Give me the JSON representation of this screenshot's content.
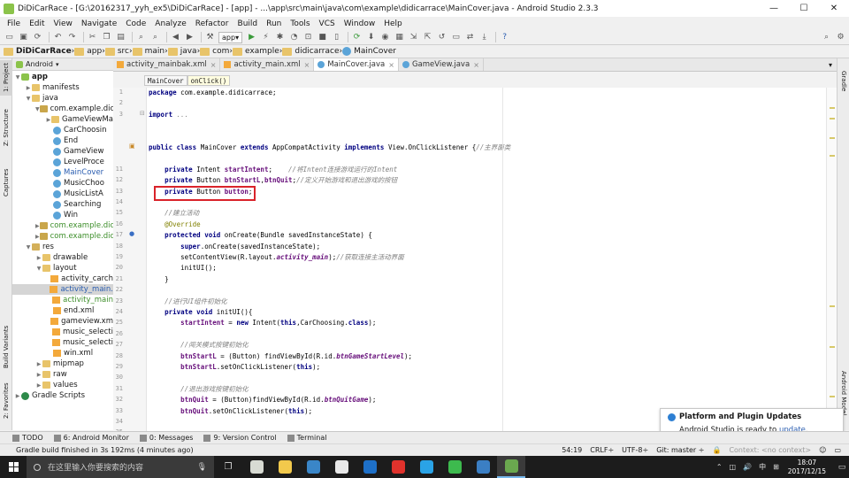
{
  "window": {
    "title": "DiDiCarRace - [G:\\20162317_yyh_ex5\\DiDiCarRace] - [app] - ...\\app\\src\\main\\java\\com\\example\\didicarrace\\MainCover.java - Android Studio 2.3.3"
  },
  "menu": [
    "File",
    "Edit",
    "View",
    "Navigate",
    "Code",
    "Analyze",
    "Refactor",
    "Build",
    "Run",
    "Tools",
    "VCS",
    "Window",
    "Help"
  ],
  "toolbar": {
    "run_config": "app",
    "run_config_arrow": "▾"
  },
  "breadcrumb": [
    "DiDiCarRace",
    "app",
    "src",
    "main",
    "java",
    "com",
    "example",
    "didicarrace",
    "MainCover"
  ],
  "project_panel": {
    "view_mode": "Android"
  },
  "tree": [
    {
      "label": "app",
      "depth": 0,
      "icon": "module",
      "arrow": "▼",
      "bold": true
    },
    {
      "label": "manifests",
      "depth": 1,
      "icon": "folder",
      "arrow": "▶"
    },
    {
      "label": "java",
      "depth": 1,
      "icon": "folder",
      "arrow": "▼"
    },
    {
      "label": "com.example.dic",
      "depth": 2,
      "icon": "pkg",
      "arrow": "▼"
    },
    {
      "label": "GameViewMa",
      "depth": 3,
      "icon": "folder",
      "arrow": "▶"
    },
    {
      "label": "CarChoosin",
      "depth": 3,
      "icon": "cls",
      "arrow": ""
    },
    {
      "label": "End",
      "depth": 3,
      "icon": "cls",
      "arrow": ""
    },
    {
      "label": "GameView",
      "depth": 3,
      "icon": "cls",
      "arrow": ""
    },
    {
      "label": "LevelProce",
      "depth": 3,
      "icon": "cls",
      "arrow": ""
    },
    {
      "label": "MainCover",
      "depth": 3,
      "icon": "cls",
      "arrow": "",
      "color": "#2a5db0"
    },
    {
      "label": "MusicChoo",
      "depth": 3,
      "icon": "cls",
      "arrow": ""
    },
    {
      "label": "MusicListA",
      "depth": 3,
      "icon": "cls",
      "arrow": ""
    },
    {
      "label": "Searching",
      "depth": 3,
      "icon": "cls",
      "arrow": ""
    },
    {
      "label": "Win",
      "depth": 3,
      "icon": "cls",
      "arrow": ""
    },
    {
      "label": "com.example.dic",
      "depth": 2,
      "icon": "pkg",
      "arrow": "▶",
      "variant": "green"
    },
    {
      "label": "com.example.dic",
      "depth": 2,
      "icon": "pkg",
      "arrow": "▶",
      "variant": "green"
    },
    {
      "label": "res",
      "depth": 1,
      "icon": "res",
      "arrow": "▼"
    },
    {
      "label": "drawable",
      "depth": 2,
      "icon": "folder",
      "arrow": "▶"
    },
    {
      "label": "layout",
      "depth": 2,
      "icon": "folder",
      "arrow": "▼"
    },
    {
      "label": "activity_carch",
      "depth": 3,
      "icon": "xml",
      "arrow": ""
    },
    {
      "label": "activity_main.",
      "depth": 3,
      "icon": "xml",
      "arrow": "",
      "selected": true,
      "color": "#2a5db0"
    },
    {
      "label": "activity_main",
      "depth": 3,
      "icon": "xml",
      "arrow": "",
      "variant": "green"
    },
    {
      "label": "end.xml",
      "depth": 3,
      "icon": "xml",
      "arrow": ""
    },
    {
      "label": "gameview.xm",
      "depth": 3,
      "icon": "xml",
      "arrow": ""
    },
    {
      "label": "music_selecti",
      "depth": 3,
      "icon": "xml",
      "arrow": ""
    },
    {
      "label": "music_selecti",
      "depth": 3,
      "icon": "xml",
      "arrow": ""
    },
    {
      "label": "win.xml",
      "depth": 3,
      "icon": "xml",
      "arrow": ""
    },
    {
      "label": "mipmap",
      "depth": 2,
      "icon": "folder",
      "arrow": "▶"
    },
    {
      "label": "raw",
      "depth": 2,
      "icon": "folder",
      "arrow": "▶"
    },
    {
      "label": "values",
      "depth": 2,
      "icon": "folder",
      "arrow": "▶"
    },
    {
      "label": "Gradle Scripts",
      "depth": 0,
      "icon": "gradle",
      "arrow": "▶"
    }
  ],
  "editor_tabs": [
    {
      "label": "activity_mainbak.xml",
      "icon": "xml",
      "active": false
    },
    {
      "label": "activity_main.xml",
      "icon": "xml",
      "active": false
    },
    {
      "label": "MainCover.java",
      "icon": "cls",
      "active": true
    },
    {
      "label": "GameView.java",
      "icon": "cls",
      "active": false
    }
  ],
  "editor_breadcrumb": [
    "MainCover",
    "onClick()"
  ],
  "line_numbers": [
    "1",
    "2",
    "3",
    "",
    "",
    "",
    "",
    "11",
    "12",
    "13",
    "14",
    "15",
    "16",
    "17",
    "18",
    "19",
    "20",
    "21",
    "22",
    "23",
    "24",
    "25",
    "26",
    "27",
    "28",
    "29",
    "30",
    "31",
    "32",
    "33",
    "34",
    "35",
    "36"
  ],
  "code_lines": [
    [
      [
        "kw",
        "package "
      ],
      [
        "",
        "com.example.didicarrace;"
      ]
    ],
    [],
    [
      [
        "kw",
        "import "
      ],
      [
        "cm",
        "..."
      ]
    ],
    [],
    [],
    [
      [
        "kw",
        "public class "
      ],
      [
        "",
        "MainCover "
      ],
      [
        "kw",
        "extends "
      ],
      [
        "",
        "AppCompatActivity "
      ],
      [
        "kw",
        "implements "
      ],
      [
        "",
        "View.OnClickListener {"
      ],
      [
        "cm",
        "//主界面类"
      ]
    ],
    [],
    [
      [
        "",
        "    "
      ],
      [
        "kw",
        "private "
      ],
      [
        "",
        "Intent "
      ],
      [
        "fld",
        "startIntent"
      ],
      [
        "",
        ";    "
      ],
      [
        "cm",
        "//将Intent连接游戏运行的Intent"
      ]
    ],
    [
      [
        "",
        "    "
      ],
      [
        "kw",
        "private "
      ],
      [
        "",
        "Button "
      ],
      [
        "fld",
        "btnStartL"
      ],
      [
        "",
        ","
      ],
      [
        "fld",
        "btnQuit"
      ],
      [
        "",
        ";"
      ],
      [
        "cm",
        "//定义开始游戏和退出游戏的按钮"
      ]
    ],
    [
      [
        "",
        "    "
      ],
      [
        "kw",
        "private "
      ],
      [
        "",
        "Button "
      ],
      [
        "fld",
        "button"
      ],
      [
        "",
        ";"
      ]
    ],
    [],
    [
      [
        "",
        "    "
      ],
      [
        "cm",
        "//建立活动"
      ]
    ],
    [
      [
        "",
        "    "
      ],
      [
        "an",
        "@Override"
      ]
    ],
    [
      [
        "",
        "    "
      ],
      [
        "kw",
        "protected void "
      ],
      [
        "",
        "onCreate(Bundle savedInstanceState) {"
      ]
    ],
    [
      [
        "",
        "        "
      ],
      [
        "kw",
        "super"
      ],
      [
        "",
        ".onCreate(savedInstanceState);"
      ]
    ],
    [
      [
        "",
        "        "
      ],
      [
        "",
        "setContentView(R.layout."
      ],
      [
        "sfld",
        "activity_main"
      ],
      [
        "",
        ");"
      ],
      [
        "cm",
        "//获取连接主活动界面"
      ]
    ],
    [
      [
        "",
        "        "
      ],
      [
        "",
        "initUI();"
      ]
    ],
    [
      [
        "",
        "    "
      ],
      [
        "",
        "}"
      ]
    ],
    [],
    [
      [
        "",
        "    "
      ],
      [
        "cm",
        "//进行UI组件初始化"
      ]
    ],
    [
      [
        "",
        "    "
      ],
      [
        "kw",
        "private void "
      ],
      [
        "",
        "initUI(){"
      ]
    ],
    [
      [
        "",
        "        "
      ],
      [
        "fld",
        "startIntent"
      ],
      [
        "",
        " = "
      ],
      [
        "kw",
        "new "
      ],
      [
        "",
        "Intent("
      ],
      [
        "kw",
        "this"
      ],
      [
        "",
        ",CarChoosing."
      ],
      [
        "kw",
        "class"
      ],
      [
        "",
        ");"
      ]
    ],
    [],
    [
      [
        "",
        "        "
      ],
      [
        "cm",
        "//闯关模式按键初始化"
      ]
    ],
    [
      [
        "",
        "        "
      ],
      [
        "fld",
        "btnStartL"
      ],
      [
        "",
        " = (Button) findViewById(R.id."
      ],
      [
        "sfld",
        "btnGameStartLevel"
      ],
      [
        "",
        ");"
      ]
    ],
    [
      [
        "",
        "        "
      ],
      [
        "fld",
        "btnStartL"
      ],
      [
        "",
        ".setOnClickListener("
      ],
      [
        "kw",
        "this"
      ],
      [
        "",
        ");"
      ]
    ],
    [],
    [
      [
        "",
        "        "
      ],
      [
        "cm",
        "//退出游戏按键初始化"
      ]
    ],
    [
      [
        "",
        "        "
      ],
      [
        "fld",
        "btnQuit"
      ],
      [
        "",
        " = (Button)findViewById(R.id."
      ],
      [
        "sfld",
        "btnQuitGame"
      ],
      [
        "",
        ");"
      ]
    ],
    [
      [
        "",
        "        "
      ],
      [
        "fld",
        "btnQuit"
      ],
      [
        "",
        ".setOnClickListener("
      ],
      [
        "kw",
        "this"
      ],
      [
        "",
        ");"
      ]
    ],
    [],
    [],
    []
  ],
  "side_tabs": {
    "left": [
      "1: Project",
      "Z: Structure",
      "Captures",
      "Build Variants",
      "2: Favorites"
    ],
    "right": [
      "Gradle",
      "Android Model"
    ]
  },
  "bottom_tools": [
    "TODO",
    "6: Android Monitor",
    "0: Messages",
    "9: Version Control",
    "Terminal"
  ],
  "status": {
    "message": "Gradle build finished in 3s 192ms (4 minutes ago)",
    "position": "54:19",
    "line_sep": "CRLF÷",
    "encoding": "UTF-8÷",
    "git": "Git: master ÷",
    "context": "Context: <no context>"
  },
  "notification": {
    "title": "Platform and Plugin Updates",
    "body": "Android Studio is ready to",
    "link": "update",
    "end": "."
  },
  "taskbar": {
    "search_placeholder": "在这里输入你要搜索的内容",
    "time": "18:07",
    "date": "2017/12/15",
    "ime": "中",
    "apps": [
      {
        "name": "chrome",
        "color": "#d8dbd3"
      },
      {
        "name": "explorer",
        "color": "#f2c94c"
      },
      {
        "name": "store",
        "color": "#3a86c8"
      },
      {
        "name": "sogou",
        "color": "#e8e8e8"
      },
      {
        "name": "media",
        "color": "#1e70c8"
      },
      {
        "name": "wps",
        "color": "#e0322c"
      },
      {
        "name": "qq",
        "color": "#2aa3e6"
      },
      {
        "name": "wechat",
        "color": "#3dba4e"
      },
      {
        "name": "feedback",
        "color": "#3b7fc4"
      },
      {
        "name": "android-studio",
        "color": "#6aa84f"
      }
    ]
  },
  "colors": {
    "highlight_box": "#d9232a",
    "selected_row": "#d5d5d5"
  }
}
